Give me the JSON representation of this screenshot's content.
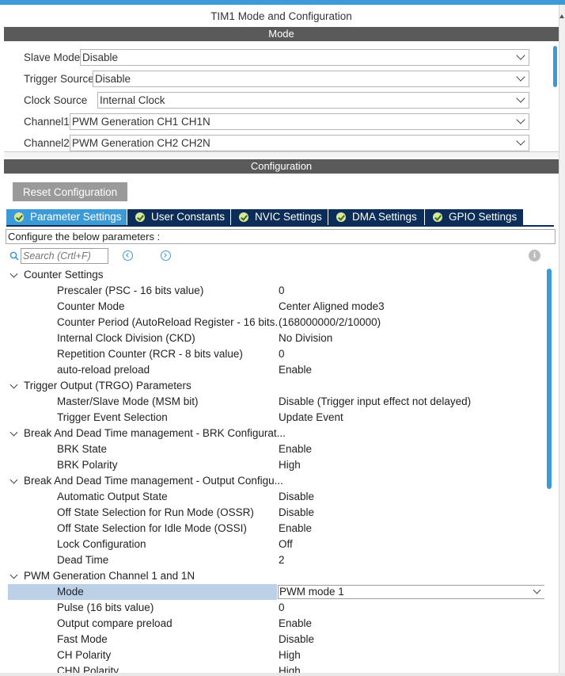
{
  "window": {
    "title": "TIM1 Mode and Configuration"
  },
  "mode": {
    "header": "Mode",
    "fields": [
      {
        "label": "Slave Mode",
        "value": "Disable"
      },
      {
        "label": "Trigger Source",
        "value": "Disable"
      },
      {
        "label": "Clock Source",
        "value": "Internal Clock"
      },
      {
        "label": "Channel1",
        "value": "PWM Generation CH1 CH1N"
      },
      {
        "label": "Channel2",
        "value": "PWM Generation CH2 CH2N"
      }
    ]
  },
  "configuration": {
    "header": "Configuration",
    "reset_label": "Reset Configuration",
    "tabs": [
      {
        "label": "Parameter Settings",
        "active": true
      },
      {
        "label": "User Constants",
        "active": false
      },
      {
        "label": "NVIC Settings",
        "active": false
      },
      {
        "label": "DMA Settings",
        "active": false
      },
      {
        "label": "GPIO Settings",
        "active": false
      }
    ],
    "instruction": "Configure the below parameters :",
    "search_placeholder": "Search (Crtl+F)",
    "info_glyph": "i",
    "rows": [
      {
        "type": "group",
        "label": "Counter Settings"
      },
      {
        "type": "param",
        "name": "Prescaler (PSC - 16 bits value)",
        "value": "0"
      },
      {
        "type": "param",
        "name": "Counter Mode",
        "value": "Center Aligned mode3"
      },
      {
        "type": "param",
        "name": "Counter Period (AutoReload Register - 16 bits...",
        "value": "(168000000/2/10000)"
      },
      {
        "type": "param",
        "name": "Internal Clock Division (CKD)",
        "value": "No Division"
      },
      {
        "type": "param",
        "name": "Repetition Counter (RCR - 8 bits value)",
        "value": "0"
      },
      {
        "type": "param",
        "name": "auto-reload preload",
        "value": "Enable"
      },
      {
        "type": "group",
        "label": "Trigger Output (TRGO) Parameters"
      },
      {
        "type": "param",
        "name": "Master/Slave Mode (MSM bit)",
        "value": "Disable (Trigger input effect not delayed)"
      },
      {
        "type": "param",
        "name": "Trigger Event Selection",
        "value": "Update Event"
      },
      {
        "type": "group",
        "label": "Break And Dead Time management - BRK Configurat..."
      },
      {
        "type": "param",
        "name": "BRK State",
        "value": "Enable"
      },
      {
        "type": "param",
        "name": "BRK Polarity",
        "value": "High"
      },
      {
        "type": "group",
        "label": "Break And Dead Time management - Output Configu..."
      },
      {
        "type": "param",
        "name": "Automatic Output State",
        "value": "Disable"
      },
      {
        "type": "param",
        "name": "Off State Selection for Run Mode (OSSR)",
        "value": "Disable"
      },
      {
        "type": "param",
        "name": "Off State Selection for Idle Mode (OSSI)",
        "value": "Enable"
      },
      {
        "type": "param",
        "name": "Lock Configuration",
        "value": "Off"
      },
      {
        "type": "param",
        "name": "Dead Time",
        "value": "2"
      },
      {
        "type": "group",
        "label": "PWM Generation Channel 1 and 1N"
      },
      {
        "type": "param",
        "name": "Mode",
        "value": "PWM mode 1",
        "selected": true
      },
      {
        "type": "param",
        "name": "Pulse (16 bits value)",
        "value": "0"
      },
      {
        "type": "param",
        "name": "Output compare preload",
        "value": "Enable"
      },
      {
        "type": "param",
        "name": "Fast Mode",
        "value": "Disable"
      },
      {
        "type": "param",
        "name": "CH Polarity",
        "value": "High"
      },
      {
        "type": "param",
        "name": "CHN Polarity",
        "value": "High"
      }
    ]
  },
  "colors": {
    "accent": "#3c9bd7",
    "tab_dark": "#0b2d57",
    "section_bar": "#5a5a5a",
    "selected_row": "#bcd0e8"
  }
}
